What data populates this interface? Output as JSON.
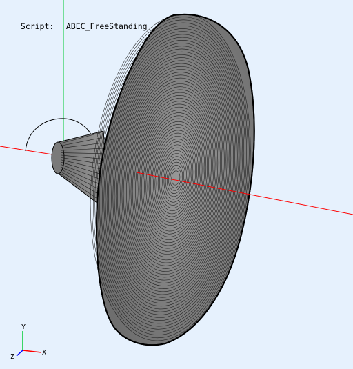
{
  "header": {
    "script_label": "Script:",
    "script_name": "ABEC_FreeStanding"
  },
  "viewport": {
    "background": "#e6f1fd",
    "model_fill": "#8a8a8a",
    "mesh_line_color": "#1c1c1c",
    "x_axis_color": "#ff0000",
    "y_axis_color": "#00cc33",
    "z_axis_color": "#0000ff"
  },
  "axes_triad": {
    "x_label": "X",
    "y_label": "Y",
    "z_label": "Z"
  }
}
